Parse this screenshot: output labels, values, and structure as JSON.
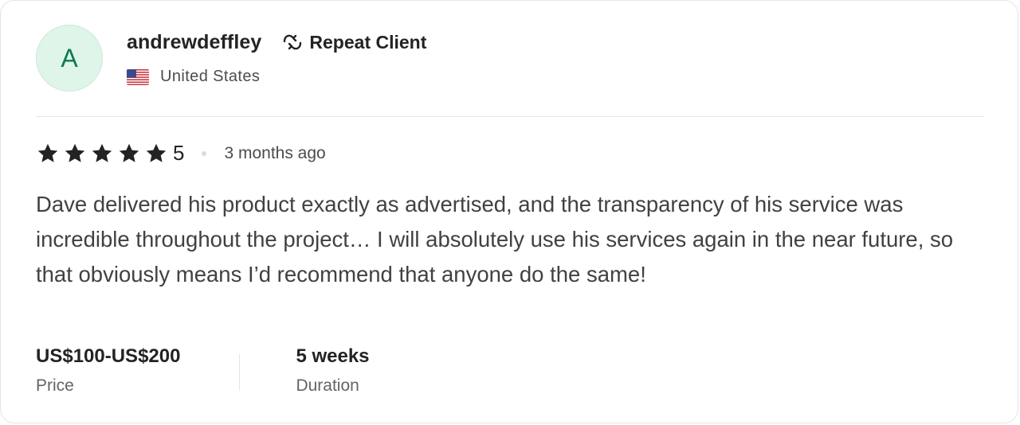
{
  "reviewer": {
    "avatar_initial": "A",
    "username": "andrewdeffley",
    "repeat_client_label": "Repeat Client",
    "country": "United States",
    "flag_icon": "us-flag-icon"
  },
  "rating": {
    "stars": 5,
    "value": "5",
    "time_ago": "3 months ago"
  },
  "review": {
    "text": "Dave delivered his product exactly as advertised, and the transparency of his service was incredible throughout the project… I will absolutely use his services again in the near future, so that obviously means I’d recommend that anyone do the same!"
  },
  "details": {
    "price_value": "US$100-US$200",
    "price_label": "Price",
    "duration_value": "5 weeks",
    "duration_label": "Duration"
  },
  "colors": {
    "avatar_bg": "#dff5ea",
    "avatar_text": "#0e7a4b",
    "star": "#222325",
    "divider": "#e4e5e7"
  }
}
